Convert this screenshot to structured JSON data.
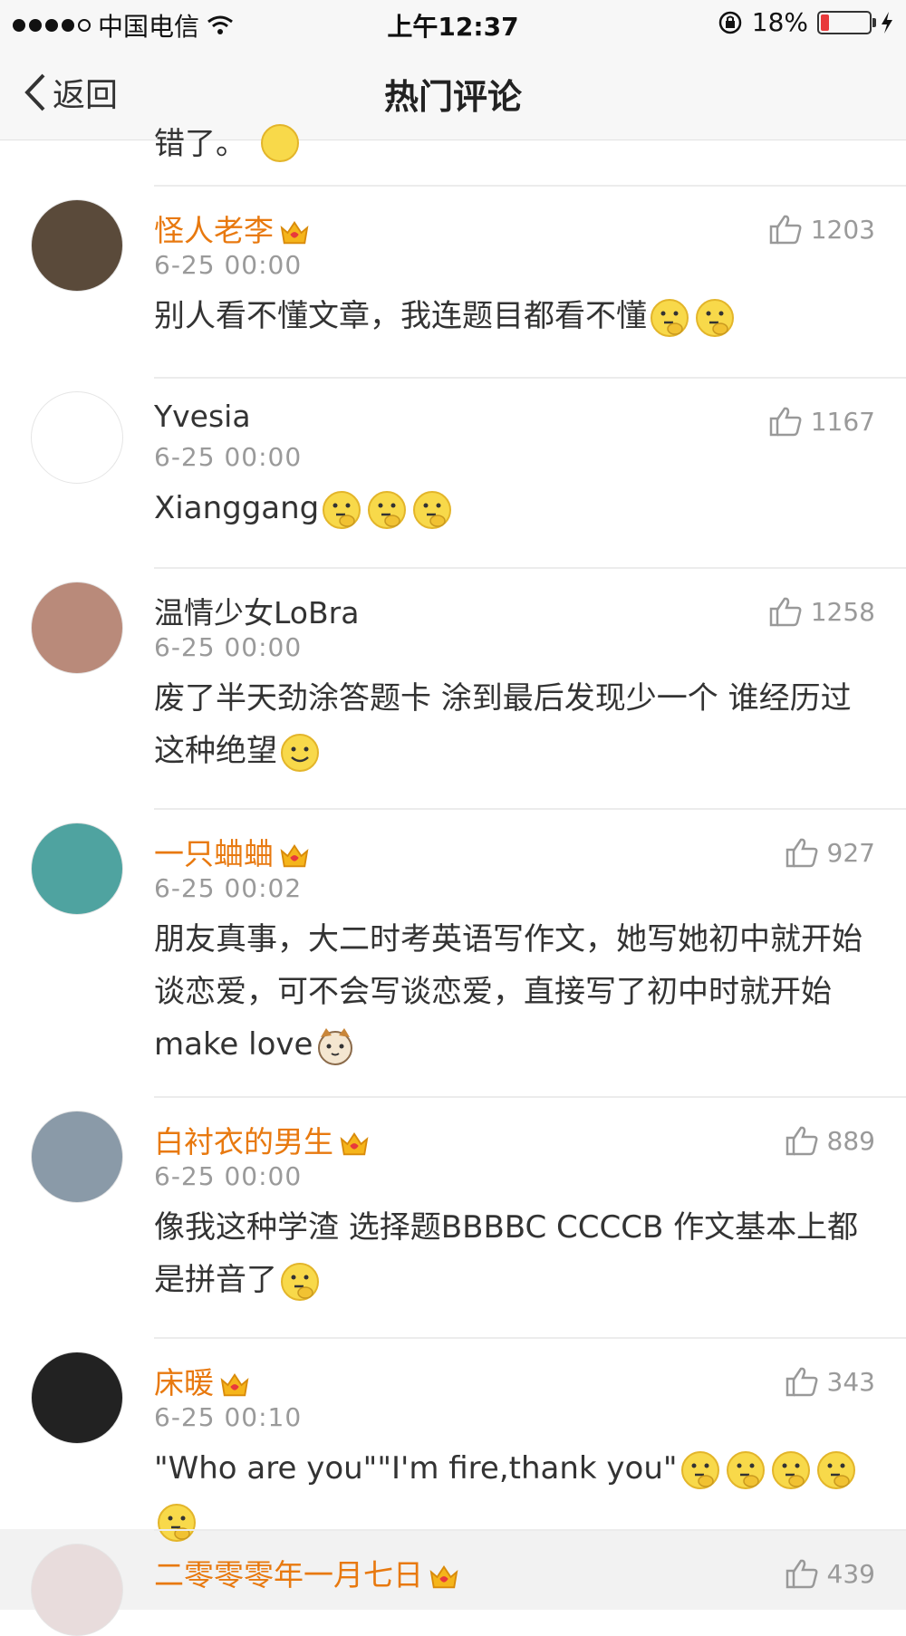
{
  "status": {
    "carrier": "中国电信",
    "time": "上午12:37",
    "battery": "18%",
    "battery_level": 0.18
  },
  "nav": {
    "back_label": "返回",
    "title": "热门评论"
  },
  "partial_text": "错了。",
  "comments": [
    {
      "name": "怪人老李",
      "vip": true,
      "time": "6-25 00:00",
      "likes": "1203",
      "text": "别人看不懂文章，我连题目都看不懂",
      "emojis": [
        "thinking",
        "thinking"
      ]
    },
    {
      "name": "Yvesia",
      "vip": false,
      "time": "6-25 00:00",
      "likes": "1167",
      "text": "Xianggang",
      "emojis": [
        "thinking",
        "thinking",
        "thinking"
      ]
    },
    {
      "name": "温情少女LoBra",
      "vip": false,
      "time": "6-25 00:00",
      "likes": "1258",
      "text": "废了半天劲涂答题卡 涂到最后发现少一个  谁经历过这种绝望",
      "emojis": [
        "smile"
      ]
    },
    {
      "name": "一只蛐蛐",
      "vip": true,
      "time": "6-25 00:02",
      "likes": "927",
      "text": "朋友真事，大二时考英语写作文，她写她初中就开始谈恋爱，可不会写谈恋爱，直接写了初中时就开始make love",
      "emojis": [
        "cat"
      ]
    },
    {
      "name": "白衬衣的男生",
      "vip": true,
      "time": "6-25 00:00",
      "likes": "889",
      "text": "像我这种学渣   选择题BBBBC  CCCCB  作文基本上都是拼音了",
      "emojis": [
        "thinking"
      ]
    },
    {
      "name": "床暖",
      "vip": true,
      "time": "6-25 00:10",
      "likes": "343",
      "text": "\"Who are you\"\"I'm fire,thank you\"",
      "emojis": [
        "thinking",
        "thinking",
        "thinking",
        "thinking",
        "thinking"
      ]
    },
    {
      "name": "二零零零年一月七日",
      "vip": true,
      "time": "",
      "likes": "439",
      "text": "",
      "emojis": []
    }
  ],
  "colors": {
    "vip_name": "#e8790f",
    "text": "#333333",
    "meta": "#9a9a9a",
    "battery_low": "#e8393b"
  }
}
